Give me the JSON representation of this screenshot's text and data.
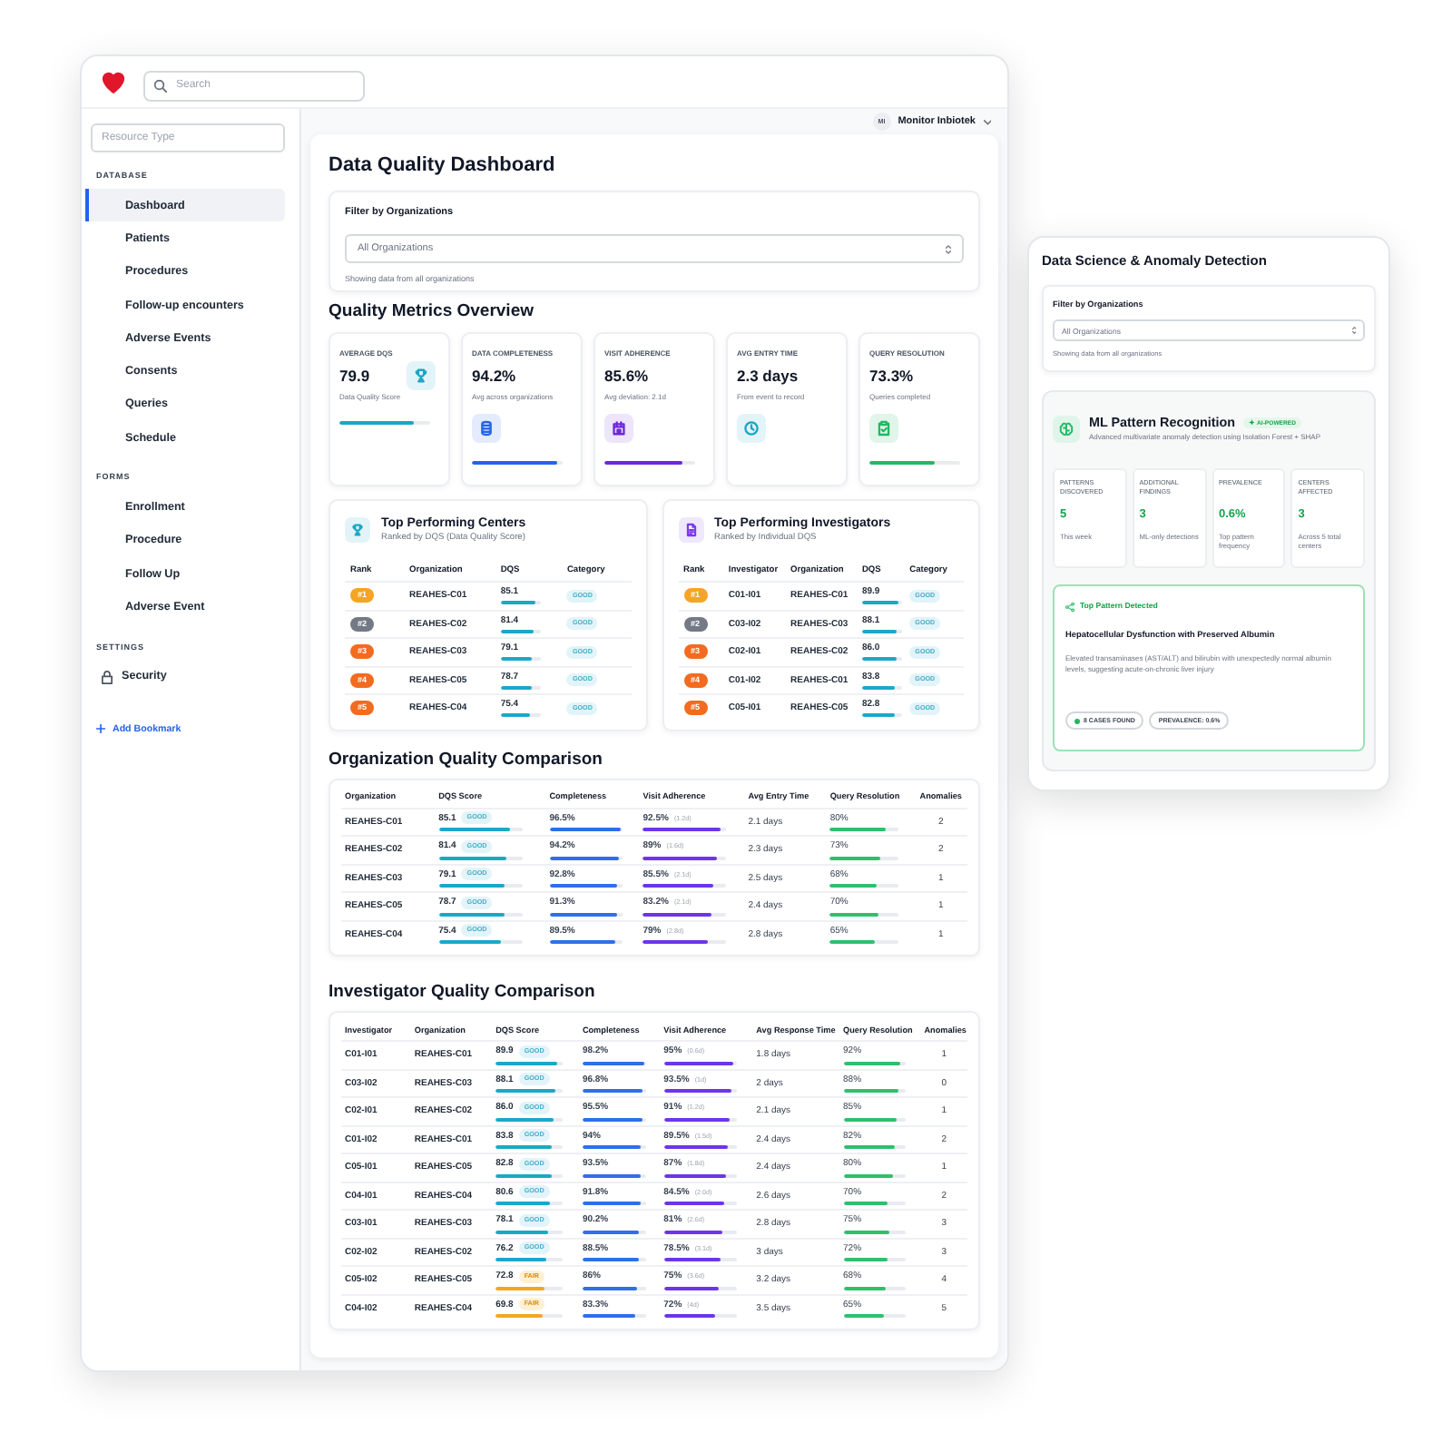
{
  "header": {
    "search": {
      "placeholder": "Search"
    },
    "user": {
      "initials": "MI",
      "name": "Monitor Inbiotek"
    }
  },
  "sidebar": {
    "filter": {
      "placeholder": "Resource Type"
    },
    "sections": [
      {
        "title": "DATABASE",
        "items": [
          {
            "label": "Dashboard",
            "kind": "plain",
            "selected": true
          },
          {
            "label": "Patients",
            "kind": "plain",
            "selected": false
          },
          {
            "label": "Procedures",
            "kind": "plain",
            "selected": false
          },
          {
            "label": "Follow-up encounters",
            "kind": "plain",
            "selected": false
          },
          {
            "label": "Adverse Events",
            "kind": "plain",
            "selected": false
          },
          {
            "label": "Consents",
            "kind": "plain",
            "selected": false
          },
          {
            "label": "Queries",
            "kind": "plain",
            "selected": false
          },
          {
            "label": "Schedule",
            "kind": "plain",
            "selected": false
          }
        ]
      },
      {
        "title": "FORMS",
        "items": [
          {
            "label": "Enrollment",
            "kind": "plain",
            "selected": false
          },
          {
            "label": "Procedure",
            "kind": "plain",
            "selected": false
          },
          {
            "label": "Follow Up",
            "kind": "plain",
            "selected": false
          },
          {
            "label": "Adverse Event",
            "kind": "plain",
            "selected": false
          }
        ]
      },
      {
        "title": "SETTINGS",
        "items": [
          {
            "label": "Security",
            "kind": "with_icon",
            "selected": false
          }
        ]
      }
    ],
    "add_bookmark": "Add Bookmark"
  },
  "dashboard": {
    "title": "Data Quality Dashboard",
    "filter": {
      "label": "Filter by Organizations",
      "value": "All Organizations",
      "hint": "Showing data from all organizations"
    },
    "metrics": {
      "title": "Quality Metrics Overview",
      "cards": [
        {
          "label": "AVERAGE DQS",
          "value": "79.9",
          "caption": "Data Quality Score",
          "level": 0.82
        },
        {
          "label": "DATA COMPLETENESS",
          "value": "94.2%",
          "caption": "Avg across organizations",
          "level": 0.94
        },
        {
          "label": "VISIT ADHERENCE",
          "value": "85.6%",
          "caption": "Avg deviation: 2.1d",
          "level": 0.86
        },
        {
          "label": "AVG ENTRY TIME",
          "value": "2.3 days",
          "caption": "From event to record"
        },
        {
          "label": "QUERY RESOLUTION",
          "value": "73.3%",
          "caption": "Queries completed",
          "level": 0.73
        }
      ]
    },
    "top_performers": [
      {
        "title": "Top Performing Centers",
        "subtitle": "Ranked by DQS (Data Quality Score)",
        "columns": [
          "Rank",
          "Organization",
          "DQS",
          "Category"
        ],
        "rows": [
          {
            "rank": "#1",
            "color": "#f5a524",
            "organization": "REAHES-C01",
            "dqs": "85.1",
            "level": 0.851,
            "category": "GOOD",
            "kind": "good"
          },
          {
            "rank": "#2",
            "color": "#737a85",
            "organization": "REAHES-C02",
            "dqs": "81.4",
            "level": 0.814,
            "category": "GOOD",
            "kind": "good"
          },
          {
            "rank": "#3",
            "color": "#f26b1f",
            "organization": "REAHES-C03",
            "dqs": "79.1",
            "level": 0.791,
            "category": "GOOD",
            "kind": "good"
          },
          {
            "rank": "#4",
            "color": "#f26b1f",
            "organization": "REAHES-C05",
            "dqs": "78.7",
            "level": 0.787,
            "category": "GOOD",
            "kind": "good"
          },
          {
            "rank": "#5",
            "color": "#f26b1f",
            "organization": "REAHES-C04",
            "dqs": "75.4",
            "level": 0.754,
            "category": "GOOD",
            "kind": "good"
          }
        ]
      },
      {
        "title": "Top Performing Investigators",
        "subtitle": "Ranked by Individual DQS",
        "columns": [
          "Rank",
          "Investigator",
          "Organization",
          "DQS",
          "Category"
        ],
        "rows": [
          {
            "rank": "#1",
            "color": "#f5a524",
            "investigator": "C01-I01",
            "organization": "REAHES-C01",
            "dqs": "89.9",
            "level": 0.899,
            "category": "GOOD",
            "kind": "good"
          },
          {
            "rank": "#2",
            "color": "#737a85",
            "investigator": "C03-I02",
            "organization": "REAHES-C03",
            "dqs": "88.1",
            "level": 0.881,
            "category": "GOOD",
            "kind": "good"
          },
          {
            "rank": "#3",
            "color": "#f26b1f",
            "investigator": "C02-I01",
            "organization": "REAHES-C02",
            "dqs": "86.0",
            "level": 0.86,
            "category": "GOOD",
            "kind": "good"
          },
          {
            "rank": "#4",
            "color": "#f26b1f",
            "investigator": "C01-I02",
            "organization": "REAHES-C01",
            "dqs": "83.8",
            "level": 0.838,
            "category": "GOOD",
            "kind": "good"
          },
          {
            "rank": "#5",
            "color": "#f26b1f",
            "investigator": "C05-I01",
            "organization": "REAHES-C05",
            "dqs": "82.8",
            "level": 0.828,
            "category": "GOOD",
            "kind": "good"
          }
        ]
      }
    ],
    "organization_comparison": {
      "title": "Organization Quality Comparison",
      "columns": [
        "Organization",
        "DQS Score",
        "Completeness",
        "Visit Adherence",
        "Avg Entry Time",
        "Query Resolution",
        "Anomalies"
      ],
      "rows": [
        {
          "organization": "REAHES-C01",
          "dqs": {
            "value": "85.1",
            "category": "GOOD",
            "kind": "good",
            "level": 0.851
          },
          "completeness": {
            "value": "96.5%",
            "level": 0.965
          },
          "adherence": {
            "value": "92.5%",
            "deviation": "(1.2d)",
            "level": 0.925
          },
          "avg_time": "2.1 days",
          "query_resolution": {
            "value": "80%",
            "level": 0.8
          },
          "anomalies": "2"
        },
        {
          "organization": "REAHES-C02",
          "dqs": {
            "value": "81.4",
            "category": "GOOD",
            "kind": "good",
            "level": 0.814
          },
          "completeness": {
            "value": "94.2%",
            "level": 0.942
          },
          "adherence": {
            "value": "89%",
            "deviation": "(1.6d)",
            "level": 0.89
          },
          "avg_time": "2.3 days",
          "query_resolution": {
            "value": "73%",
            "level": 0.73
          },
          "anomalies": "2"
        },
        {
          "organization": "REAHES-C03",
          "dqs": {
            "value": "79.1",
            "category": "GOOD",
            "kind": "good",
            "level": 0.791
          },
          "completeness": {
            "value": "92.8%",
            "level": 0.928
          },
          "adherence": {
            "value": "85.5%",
            "deviation": "(2.1d)",
            "level": 0.855
          },
          "avg_time": "2.5 days",
          "query_resolution": {
            "value": "68%",
            "level": 0.68
          },
          "anomalies": "1"
        },
        {
          "organization": "REAHES-C05",
          "dqs": {
            "value": "78.7",
            "category": "GOOD",
            "kind": "good",
            "level": 0.787
          },
          "completeness": {
            "value": "91.3%",
            "level": 0.913
          },
          "adherence": {
            "value": "83.2%",
            "deviation": "(2.1d)",
            "level": 0.832
          },
          "avg_time": "2.4 days",
          "query_resolution": {
            "value": "70%",
            "level": 0.7
          },
          "anomalies": "1"
        },
        {
          "organization": "REAHES-C04",
          "dqs": {
            "value": "75.4",
            "category": "GOOD",
            "kind": "good",
            "level": 0.754
          },
          "completeness": {
            "value": "89.5%",
            "level": 0.895
          },
          "adherence": {
            "value": "79%",
            "deviation": "(2.8d)",
            "level": 0.79
          },
          "avg_time": "2.8 days",
          "query_resolution": {
            "value": "65%",
            "level": 0.65
          },
          "anomalies": "1"
        }
      ]
    },
    "investigator_comparison": {
      "title": "Investigator Quality Comparison",
      "columns": [
        "Investigator",
        "Organization",
        "DQS Score",
        "Completeness",
        "Visit Adherence",
        "Avg Response Time",
        "Query Resolution",
        "Anomalies"
      ],
      "rows": [
        {
          "investigator": "C01-I01",
          "organization": "REAHES-C01",
          "dqs": {
            "value": "89.9",
            "category": "GOOD",
            "kind": "good",
            "level": 0.899
          },
          "completeness": {
            "value": "98.2%",
            "level": 0.982
          },
          "adherence": {
            "value": "95%",
            "deviation": "(0.6d)",
            "level": 0.95
          },
          "avg_time": "1.8 days",
          "query_resolution": {
            "value": "92%",
            "level": 0.92
          },
          "anomalies": "1"
        },
        {
          "investigator": "C03-I02",
          "organization": "REAHES-C03",
          "dqs": {
            "value": "88.1",
            "category": "GOOD",
            "kind": "good",
            "level": 0.881
          },
          "completeness": {
            "value": "96.8%",
            "level": 0.968
          },
          "adherence": {
            "value": "93.5%",
            "deviation": "(1d)",
            "level": 0.935
          },
          "avg_time": "2 days",
          "query_resolution": {
            "value": "88%",
            "level": 0.88
          },
          "anomalies": "0"
        },
        {
          "investigator": "C02-I01",
          "organization": "REAHES-C02",
          "dqs": {
            "value": "86.0",
            "category": "GOOD",
            "kind": "good",
            "level": 0.86
          },
          "completeness": {
            "value": "95.5%",
            "level": 0.955
          },
          "adherence": {
            "value": "91%",
            "deviation": "(1.2d)",
            "level": 0.91
          },
          "avg_time": "2.1 days",
          "query_resolution": {
            "value": "85%",
            "level": 0.85
          },
          "anomalies": "1"
        },
        {
          "investigator": "C01-I02",
          "organization": "REAHES-C01",
          "dqs": {
            "value": "83.8",
            "category": "GOOD",
            "kind": "good",
            "level": 0.838
          },
          "completeness": {
            "value": "94%",
            "level": 0.94
          },
          "adherence": {
            "value": "89.5%",
            "deviation": "(1.5d)",
            "level": 0.895
          },
          "avg_time": "2.4 days",
          "query_resolution": {
            "value": "82%",
            "level": 0.82
          },
          "anomalies": "2"
        },
        {
          "investigator": "C05-I01",
          "organization": "REAHES-C05",
          "dqs": {
            "value": "82.8",
            "category": "GOOD",
            "kind": "good",
            "level": 0.828
          },
          "completeness": {
            "value": "93.5%",
            "level": 0.935
          },
          "adherence": {
            "value": "87%",
            "deviation": "(1.8d)",
            "level": 0.87
          },
          "avg_time": "2.4 days",
          "query_resolution": {
            "value": "80%",
            "level": 0.8
          },
          "anomalies": "1"
        },
        {
          "investigator": "C04-I01",
          "organization": "REAHES-C04",
          "dqs": {
            "value": "80.6",
            "category": "GOOD",
            "kind": "good",
            "level": 0.806
          },
          "completeness": {
            "value": "91.8%",
            "level": 0.918
          },
          "adherence": {
            "value": "84.5%",
            "deviation": "(2.0d)",
            "level": 0.845
          },
          "avg_time": "2.6 days",
          "query_resolution": {
            "value": "70%",
            "level": 0.7
          },
          "anomalies": "2"
        },
        {
          "investigator": "C03-I01",
          "organization": "REAHES-C03",
          "dqs": {
            "value": "78.1",
            "category": "GOOD",
            "kind": "good",
            "level": 0.781
          },
          "completeness": {
            "value": "90.2%",
            "level": 0.902
          },
          "adherence": {
            "value": "81%",
            "deviation": "(2.6d)",
            "level": 0.81
          },
          "avg_time": "2.8 days",
          "query_resolution": {
            "value": "75%",
            "level": 0.75
          },
          "anomalies": "3"
        },
        {
          "investigator": "C02-I02",
          "organization": "REAHES-C02",
          "dqs": {
            "value": "76.2",
            "category": "GOOD",
            "kind": "good",
            "level": 0.762
          },
          "completeness": {
            "value": "88.5%",
            "level": 0.885
          },
          "adherence": {
            "value": "78.5%",
            "deviation": "(3.1d)",
            "level": 0.785
          },
          "avg_time": "3 days",
          "query_resolution": {
            "value": "72%",
            "level": 0.72
          },
          "anomalies": "3"
        },
        {
          "investigator": "C05-I02",
          "organization": "REAHES-C05",
          "dqs": {
            "value": "72.8",
            "category": "FAIR",
            "kind": "fair",
            "level": 0.728
          },
          "completeness": {
            "value": "86%",
            "level": 0.86
          },
          "adherence": {
            "value": "75%",
            "deviation": "(3.6d)",
            "level": 0.75
          },
          "avg_time": "3.2 days",
          "query_resolution": {
            "value": "68%",
            "level": 0.68
          },
          "anomalies": "4"
        },
        {
          "investigator": "C04-I02",
          "organization": "REAHES-C04",
          "dqs": {
            "value": "69.8",
            "category": "FAIR",
            "kind": "fair",
            "level": 0.698
          },
          "completeness": {
            "value": "83.3%",
            "level": 0.833
          },
          "adherence": {
            "value": "72%",
            "deviation": "(4d)",
            "level": 0.72
          },
          "avg_time": "3.5 days",
          "query_resolution": {
            "value": "65%",
            "level": 0.65
          },
          "anomalies": "5"
        }
      ]
    }
  },
  "anomaly_panel": {
    "title": "Data Science & Anomaly Detection",
    "filter": {
      "label": "Filter by Organizations",
      "value": "All Organizations",
      "hint": "Showing data from all organizations"
    },
    "ml": {
      "title": "ML Pattern Recognition",
      "badge": "AI-POWERED",
      "subtitle": "Advanced multivariate anomaly detection using Isolation Forest + SHAP",
      "stats": [
        {
          "label": "PATTERNS DISCOVERED",
          "value": "5",
          "caption": "This week"
        },
        {
          "label": "ADDITIONAL FINDINGS",
          "value": "3",
          "caption": "ML-only detections"
        },
        {
          "label": "PREVALENCE",
          "value": "0.6%",
          "caption": "Top pattern frequency"
        },
        {
          "label": "CENTERS AFFECTED",
          "value": "3",
          "caption": "Across 5 total centers"
        }
      ],
      "top_pattern": {
        "heading": "Top Pattern Detected",
        "title": "Hepatocellular Dysfunction with Preserved Albumin",
        "description": "Elevated transaminases (AST/ALT) and bilirubin with unexpectedly normal albumin levels, suggesting acute-on-chronic liver injury",
        "chips": [
          {
            "label": "8 CASES FOUND",
            "kind": "dot"
          },
          {
            "label": "PREVALENCE: 0.6%",
            "kind": "plain"
          }
        ]
      }
    }
  }
}
